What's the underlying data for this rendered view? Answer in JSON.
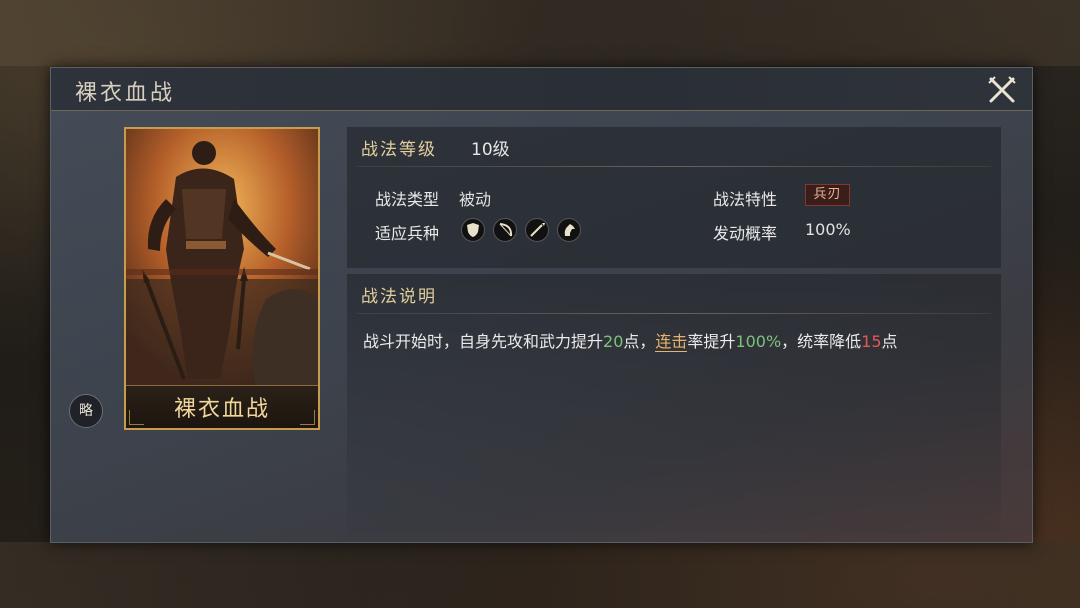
{
  "dialog": {
    "title": "裸衣血战"
  },
  "card": {
    "name": "裸衣血战"
  },
  "strategy_badge": "略",
  "info": {
    "level_label": "战法等级",
    "level_value": "10级",
    "type_label": "战法类型",
    "type_value": "被动",
    "trait_label": "战法特性",
    "trait_value": "兵刃",
    "troops_label": "适应兵种",
    "troops": [
      "shield-icon",
      "bow-icon",
      "spear-icon",
      "horse-icon"
    ],
    "rate_label": "发动概率",
    "rate_value": "100%"
  },
  "description": {
    "header": "战法说明",
    "segments": {
      "s1": "战斗开始时，自身先攻和武力提升",
      "s2": "20",
      "s3": "点，",
      "s4": "连击",
      "s5": "率提升",
      "s6": "100%",
      "s7": "，统率降低",
      "s8": "15",
      "s9": "点"
    }
  },
  "colors": {
    "accent_gold": "#e3cf9d",
    "positive_green": "#7ec27c",
    "negative_red": "#de5a54",
    "keyword_orange": "#e6b36b"
  }
}
